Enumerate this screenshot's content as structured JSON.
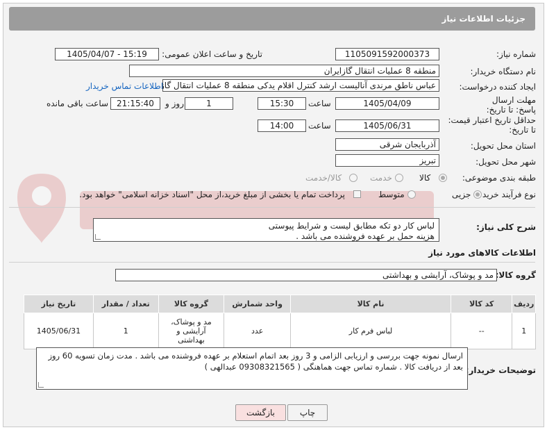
{
  "header": {
    "title": "جزئیات اطلاعات نیاز"
  },
  "fields": {
    "need_number_label": "شماره نیاز:",
    "need_number": "1105091592000373",
    "announce_label": "تاریخ و ساعت اعلان عمومی:",
    "announce_value": "1405/04/07 - 15:19",
    "buyer_org_label": "نام دستگاه خریدار:",
    "buyer_org": "منطقه 8 عملیات انتقال گازایران",
    "creator_label": "ایجاد کننده درخواست:",
    "creator": "عباس ناطق مرندی آنالیست ارشد کنترل اقلام یدکی منطقه 8 عملیات انتقال گاز",
    "contact_link": "اطلاعات تماس خریدار",
    "reply_deadline_label": "مهلت ارسال پاسخ: تا تاریخ:",
    "reply_date": "1405/04/09",
    "time_label": "ساعت",
    "reply_time": "15:30",
    "days_value": "1",
    "days_label": "روز و",
    "remaining_time": "21:15:40",
    "remaining_label": "ساعت باقی مانده",
    "price_deadline_label": "حداقل تاریخ اعتبار قیمت: تا تاریخ:",
    "price_date": "1405/06/31",
    "price_time": "14:00",
    "province_label": "استان محل تحویل:",
    "province": "آذربایجان شرقی",
    "city_label": "شهر محل تحویل:",
    "city": "تبریز",
    "category_label": "طبقه بندی موضوعی:",
    "category_options": [
      "کالا",
      "خدمت",
      "کالا/خدمت"
    ],
    "process_label": "نوع فرآیند خرید :",
    "process_options": [
      "جزیی",
      "متوسط"
    ],
    "payment_note": "پرداخت تمام یا بخشی از مبلغ خرید،از محل \"اسناد خزانه اسلامی\" خواهد بود."
  },
  "description": {
    "label": "شرح کلی نیاز:",
    "line1": "لباس کار دو تکه مطابق لیست و شرایط پیوستی",
    "line2": "هزینه حمل بر عهده فروشنده می باشد ."
  },
  "goods": {
    "section_title": "اطلاعات کالاهای مورد نیاز",
    "group_label": "گروه کالا:",
    "group_value": "مد و پوشاک، آرایشی و بهداشتی"
  },
  "table": {
    "headers": [
      "ردیف",
      "کد کالا",
      "نام کالا",
      "واحد شمارش",
      "گروه کالا",
      "تعداد / مقدار",
      "تاریخ نیاز"
    ],
    "rows": [
      {
        "row": "1",
        "code": "--",
        "name": "لباس فرم کار",
        "unit": "عدد",
        "group": "مد و پوشاک، آرایشی و بهداشتی",
        "qty": "1",
        "date": "1405/06/31"
      }
    ]
  },
  "buyer_notes": {
    "label": "توضیحات خریدار:",
    "line1": "ارسال نمونه جهت بررسی و ارزیابی الزامی و 3 روز بعد اتمام استعلام بر عهده فروشنده می باشد . مدت زمان تسویه 60 روز",
    "line2": "بعد از دریافت کالا . شماره تماس جهت هماهنگی ( 09308321565 عبدالهی )"
  },
  "buttons": {
    "print": "چاپ",
    "back": "بازگشت"
  },
  "colors": {
    "header_bg": "#9c9c9c",
    "link": "#1565c0",
    "back_bg": "#f9e0e0"
  }
}
